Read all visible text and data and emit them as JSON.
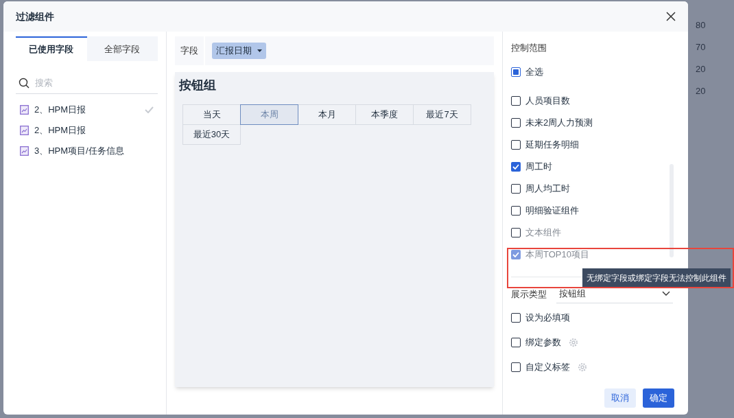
{
  "background": {
    "numbers": [
      "80",
      "70",
      "20",
      "20"
    ]
  },
  "dialog": {
    "title": "过滤组件",
    "tabs": [
      {
        "label": "已使用字段",
        "selected": true
      },
      {
        "label": "全部字段",
        "selected": false
      }
    ],
    "search": {
      "placeholder": "搜索"
    },
    "datasets": [
      {
        "label": "2、HPM日报",
        "selected": true
      },
      {
        "label": "2、HPM日报",
        "selected": false
      },
      {
        "label": "3、HPM项目/任务信息",
        "selected": false
      }
    ],
    "field": {
      "label": "字段",
      "value": "汇报日期"
    },
    "preview": {
      "title": "按钮组",
      "buttons": [
        {
          "label": "当天",
          "selected": false
        },
        {
          "label": "本周",
          "selected": true
        },
        {
          "label": "本月",
          "selected": false
        },
        {
          "label": "本季度",
          "selected": false
        },
        {
          "label": "最近7天",
          "selected": false
        },
        {
          "label": "最近30天",
          "selected": false
        }
      ]
    },
    "control_scope": {
      "title": "控制范围",
      "select_all": {
        "label": "全选",
        "indeterminate": true
      },
      "items": [
        {
          "label": "人员项目数",
          "checked": false,
          "disabled": false
        },
        {
          "label": "未来2周人力预测",
          "checked": false,
          "disabled": false
        },
        {
          "label": "延期任务明细",
          "checked": false,
          "disabled": false
        },
        {
          "label": "周工时",
          "checked": true,
          "disabled": false
        },
        {
          "label": "周人均工时",
          "checked": false,
          "disabled": false
        },
        {
          "label": "明细验证组件",
          "checked": false,
          "disabled": false
        },
        {
          "label": "文本组件",
          "checked": false,
          "disabled": true
        },
        {
          "label": "本周TOP10项目",
          "checked": true,
          "disabled": true
        }
      ]
    },
    "tooltip": "无绑定字段或绑定字段无法控制此组件",
    "display_type": {
      "label": "展示类型",
      "value": "按钮组"
    },
    "options": [
      {
        "label": "设为必填项",
        "checked": false,
        "gear": false
      },
      {
        "label": "绑定参数",
        "checked": false,
        "gear": true
      },
      {
        "label": "自定义标签",
        "checked": false,
        "gear": true
      }
    ],
    "buttons": [
      {
        "label": "取消",
        "kind": "secondary"
      },
      {
        "label": "确定",
        "kind": "primary"
      }
    ]
  }
}
